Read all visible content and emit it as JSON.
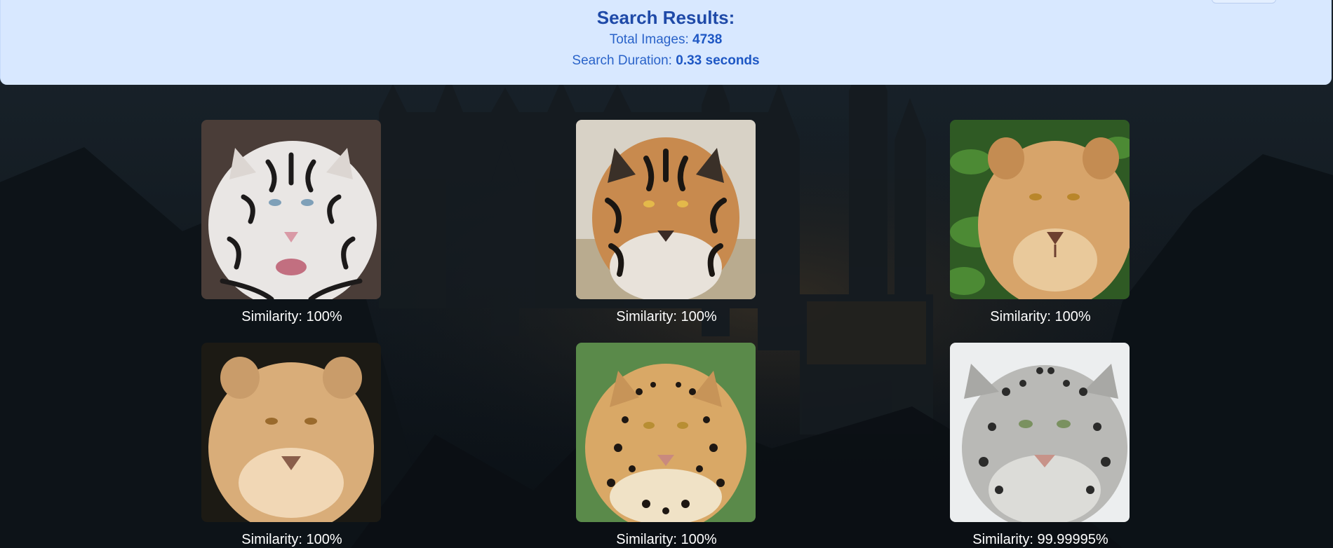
{
  "header": {
    "title": "Search Results:",
    "total_label": "Total Images: ",
    "total_value": "4738",
    "duration_label": "Search Duration: ",
    "duration_value": "0.33 seconds"
  },
  "results": [
    {
      "image": "white-tiger-icon",
      "similarity_label": "Similarity: 100%"
    },
    {
      "image": "bengal-tiger-icon",
      "similarity_label": "Similarity: 100%"
    },
    {
      "image": "lioness-grass-icon",
      "similarity_label": "Similarity: 100%"
    },
    {
      "image": "lioness-dark-icon",
      "similarity_label": "Similarity: 100%"
    },
    {
      "image": "leopard-icon",
      "similarity_label": "Similarity: 100%"
    },
    {
      "image": "snow-leopard-icon",
      "similarity_label": "Similarity: 99.99995%"
    }
  ],
  "colors": {
    "header_bg": "#d8e8ff",
    "header_text": "#1f55b8",
    "page_bg": "#0b1117",
    "caption_text": "#ffffff"
  }
}
